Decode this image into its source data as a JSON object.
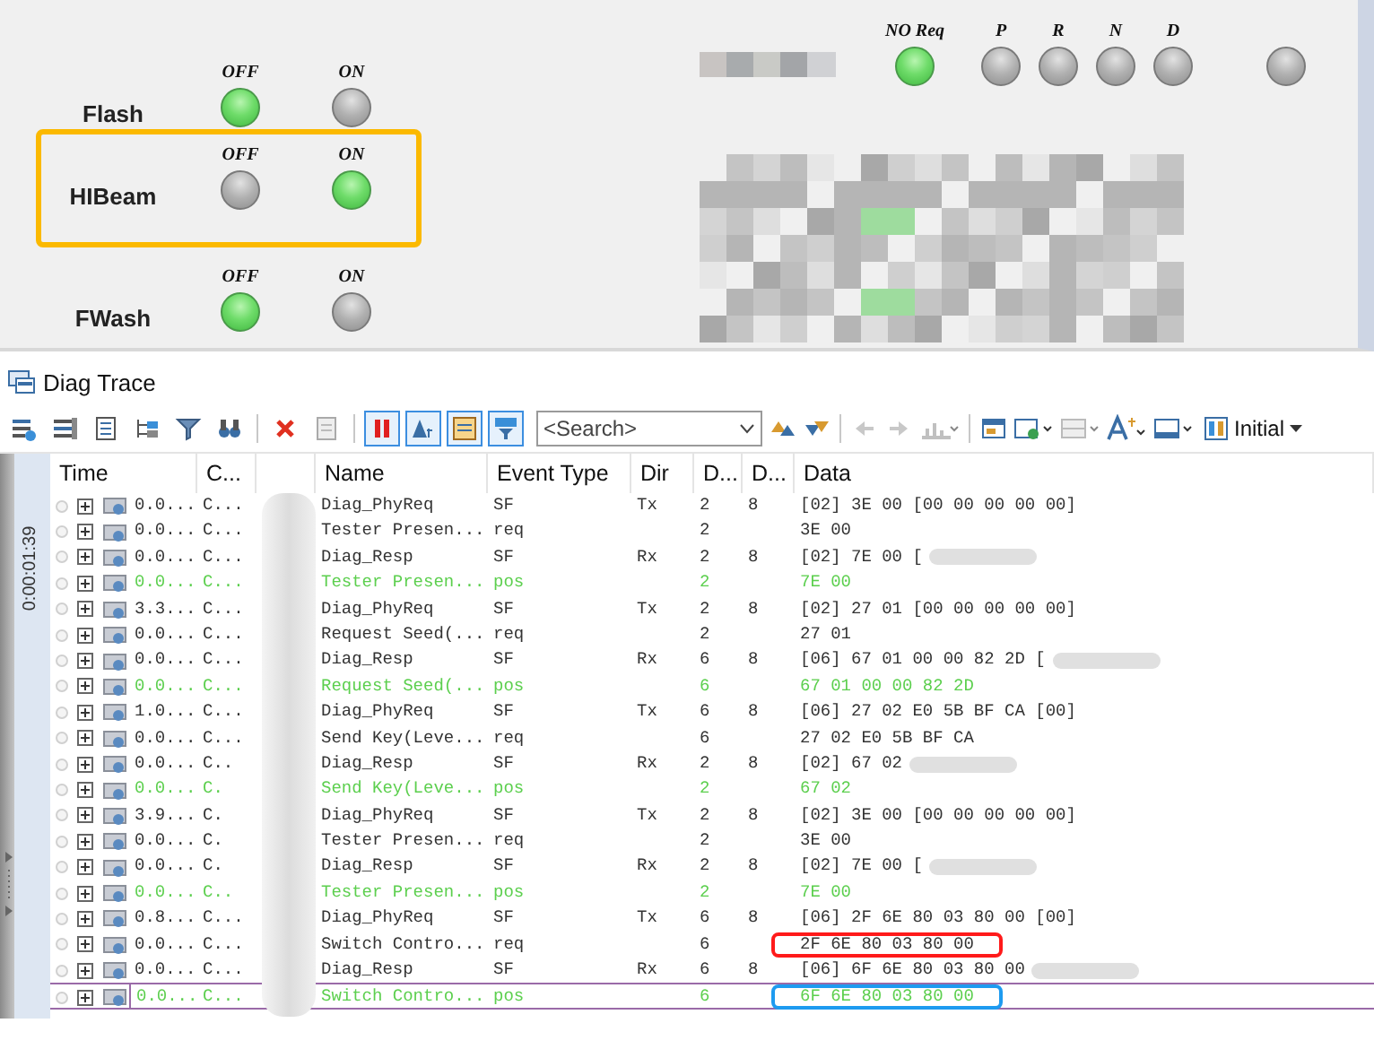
{
  "control_panel": {
    "lamp_groups": [
      {
        "label": "Flash",
        "framed": false,
        "lamps": [
          {
            "caption": "OFF",
            "on": true
          },
          {
            "caption": "ON",
            "on": false
          }
        ]
      },
      {
        "label": "HIBeam",
        "framed": true,
        "lamps": [
          {
            "caption": "OFF",
            "on": false
          },
          {
            "caption": "ON",
            "on": true
          }
        ]
      },
      {
        "label": "FWash",
        "framed": false,
        "lamps": [
          {
            "caption": "OFF",
            "on": true
          },
          {
            "caption": "ON",
            "on": false
          }
        ]
      }
    ],
    "gear_lamps": [
      {
        "caption": "NO Req",
        "on": true
      },
      {
        "caption": "P",
        "on": false
      },
      {
        "caption": "R",
        "on": false
      },
      {
        "caption": "N",
        "on": false
      },
      {
        "caption": "D",
        "on": false
      },
      {
        "on": false
      }
    ]
  },
  "trace": {
    "title": "Diag Trace",
    "toolbar_buttons": [
      {
        "pressed": false
      },
      {
        "pressed": false
      },
      {
        "pressed": false
      },
      {
        "pressed": false
      },
      {
        "pressed": false
      },
      {
        "pressed": false
      },
      {
        "pressed": false
      },
      {
        "pressed": false
      },
      {
        "pressed": true
      },
      {
        "pressed": true
      },
      {
        "pressed": true
      },
      {
        "pressed": true
      }
    ],
    "search": {
      "placeholder": "<Search>"
    },
    "view_menu": "Initial",
    "time_ruler": "0:00:01:39",
    "columns": [
      "Time",
      "C...",
      "Name",
      "Event Type",
      "Dir",
      "D...",
      "D...",
      "Data"
    ],
    "rows": [
      {
        "time": "0.0...",
        "channel": "C...",
        "name": "Diag_PhyReq",
        "event_type": "SF",
        "dir": "Tx",
        "d1": "2",
        "d2": "8",
        "data": "[02] 3E 00 [00 00 00 00 00]",
        "positive": false,
        "redacted": false,
        "selected": false
      },
      {
        "time": "0.0...",
        "channel": "C...",
        "name": "Tester Presen...",
        "event_type": "req",
        "d1": "2",
        "data": "3E 00",
        "positive": false,
        "redacted": false,
        "selected": false
      },
      {
        "time": "0.0...",
        "channel": "C...",
        "name": "Diag_Resp",
        "event_type": "SF",
        "dir": "Rx",
        "d1": "2",
        "d2": "8",
        "data": "[02] 7E 00 [",
        "positive": false,
        "redacted": true,
        "selected": false
      },
      {
        "time": "0.0...",
        "channel": "C...",
        "name": "Tester Presen...",
        "event_type": "pos",
        "d1": "2",
        "data": "7E 00",
        "positive": true,
        "redacted": false,
        "selected": false
      },
      {
        "time": "3.3...",
        "channel": "C...",
        "name": "Diag_PhyReq",
        "event_type": "SF",
        "dir": "Tx",
        "d1": "2",
        "d2": "8",
        "data": "[02] 27 01 [00 00 00 00 00]",
        "positive": false,
        "redacted": false,
        "selected": false
      },
      {
        "time": "0.0...",
        "channel": "C...",
        "name": "Request Seed(...",
        "event_type": "req",
        "d1": "2",
        "data": "27 01",
        "positive": false,
        "redacted": false,
        "selected": false
      },
      {
        "time": "0.0...",
        "channel": "C...",
        "name": "Diag_Resp",
        "event_type": "SF",
        "dir": "Rx",
        "d1": "6",
        "d2": "8",
        "data": "[06] 67 01 00 00 82 2D [",
        "positive": false,
        "redacted": true,
        "selected": false
      },
      {
        "time": "0.0...",
        "channel": "C...",
        "name": "Request Seed(...",
        "event_type": "pos",
        "d1": "6",
        "data": "67 01 00 00 82 2D",
        "positive": true,
        "redacted": false,
        "selected": false
      },
      {
        "time": "1.0...",
        "channel": "C...",
        "name": "Diag_PhyReq",
        "event_type": "SF",
        "dir": "Tx",
        "d1": "6",
        "d2": "8",
        "data": "[06] 27 02 E0 5B BF CA [00]",
        "positive": false,
        "redacted": false,
        "selected": false
      },
      {
        "time": "0.0...",
        "channel": "C...",
        "name": "Send Key(Leve...",
        "event_type": "req",
        "d1": "6",
        "data": "27 02 E0 5B BF CA",
        "positive": false,
        "redacted": false,
        "selected": false
      },
      {
        "time": "0.0...",
        "channel": "C..",
        "name": "Diag_Resp",
        "event_type": "SF",
        "dir": "Rx",
        "d1": "2",
        "d2": "8",
        "data": "[02] 67 02",
        "positive": false,
        "redacted": true,
        "selected": false
      },
      {
        "time": "0.0...",
        "channel": "C.",
        "name": "Send Key(Leve...",
        "event_type": "pos",
        "d1": "2",
        "data": "67 02",
        "positive": true,
        "redacted": false,
        "selected": false
      },
      {
        "time": "3.9...",
        "channel": "C.",
        "name": "Diag_PhyReq",
        "event_type": "SF",
        "dir": "Tx",
        "d1": "2",
        "d2": "8",
        "data": "[02] 3E 00 [00 00 00 00 00]",
        "positive": false,
        "redacted": false,
        "selected": false
      },
      {
        "time": "0.0...",
        "channel": "C.",
        "name": "Tester Presen...",
        "event_type": "req",
        "d1": "2",
        "data": "3E 00",
        "positive": false,
        "redacted": false,
        "selected": false
      },
      {
        "time": "0.0...",
        "channel": "C.",
        "name": "Diag_Resp",
        "event_type": "SF",
        "dir": "Rx",
        "d1": "2",
        "d2": "8",
        "data": "[02] 7E 00 [",
        "positive": false,
        "redacted": true,
        "selected": false
      },
      {
        "time": "0.0...",
        "channel": "C..",
        "name": "Tester Presen...",
        "event_type": "pos",
        "d1": "2",
        "data": "7E 00",
        "positive": true,
        "redacted": false,
        "selected": false
      },
      {
        "time": "0.8...",
        "channel": "C...",
        "name": "Diag_PhyReq",
        "event_type": "SF",
        "dir": "Tx",
        "d1": "6",
        "d2": "8",
        "data": "[06] 2F 6E 80 03 80 00 [00]",
        "positive": false,
        "redacted": false,
        "selected": false
      },
      {
        "time": "0.0...",
        "channel": "C...",
        "name": "Switch Contro...",
        "event_type": "req",
        "d1": "6",
        "data": "2F 6E 80 03 80 00",
        "positive": false,
        "redacted": false,
        "selected": false,
        "color": "#ff1a1a"
      },
      {
        "time": "0.0...",
        "channel": "C...",
        "name": "Diag_Resp",
        "event_type": "SF",
        "dir": "Rx",
        "d1": "6",
        "d2": "8",
        "data": "[06] 6F 6E 80 03 80 00",
        "positive": false,
        "redacted": true,
        "selected": false
      },
      {
        "time": "0.0...",
        "channel": "C...",
        "name": "Switch Contro...",
        "event_type": "pos",
        "d1": "6",
        "data": "6F 6E 80 03 80 00",
        "positive": true,
        "redacted": false,
        "selected": true,
        "color": "#1e9bf0"
      }
    ]
  }
}
